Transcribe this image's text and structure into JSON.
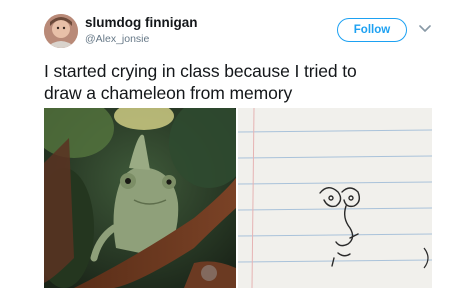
{
  "tweet": {
    "display_name": "slumdog finnigan",
    "handle": "@Alex_jonsie",
    "follow_label": "Follow",
    "text_line_1": "I started crying in class because I tried to",
    "text_line_2": "draw a chameleon from memory"
  },
  "icons": {
    "menu": "chevron-down-icon"
  },
  "colors": {
    "accent": "#1da1f2",
    "text": "#14171a",
    "secondary_text": "#657786"
  }
}
